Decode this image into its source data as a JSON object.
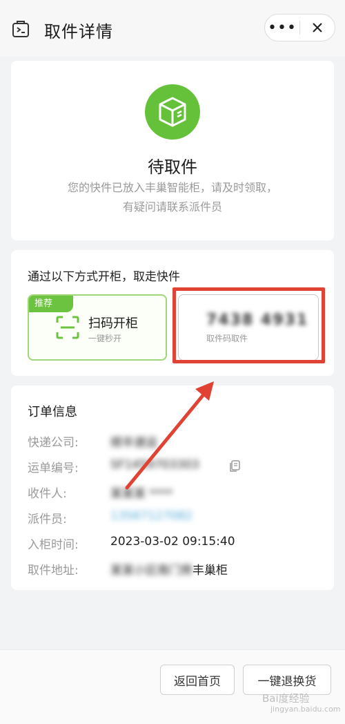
{
  "header": {
    "title": "取件详情",
    "more_label": "•••",
    "close_label": "✕"
  },
  "status": {
    "title": "待取件",
    "desc_line1": "您的快件已放入丰巢智能柜，请及时领取，",
    "desc_line2": "有疑问请联系派件员",
    "accent": "#66c13a"
  },
  "open_methods": {
    "title": "通过以下方式开柜，取走快件",
    "scan": {
      "badge": "推荐",
      "label": "扫码开柜",
      "sub": "一键秒开"
    },
    "code": {
      "value": "7438 4931",
      "sub": "取件码取件"
    }
  },
  "order": {
    "title": "订单信息",
    "rows": [
      {
        "label": "快递公司:",
        "value": "顺丰速运"
      },
      {
        "label": "运单编号:",
        "value": "SF1459703303"
      },
      {
        "label": "收件人:",
        "value": "某某某 ****"
      },
      {
        "label": "派件员:",
        "value": "13567127082"
      },
      {
        "label": "入柜时间:",
        "value": "2023-03-02 09:15:40"
      },
      {
        "label": "取件地址:",
        "value_hidden": "某某小区南门旁",
        "value_visible": "丰巢柜"
      }
    ]
  },
  "footer": {
    "home_label": "返回首页",
    "return_label": "一键退换货"
  },
  "watermark": {
    "brand": "Bai度经验",
    "url": "jingyan.baidu.com"
  }
}
